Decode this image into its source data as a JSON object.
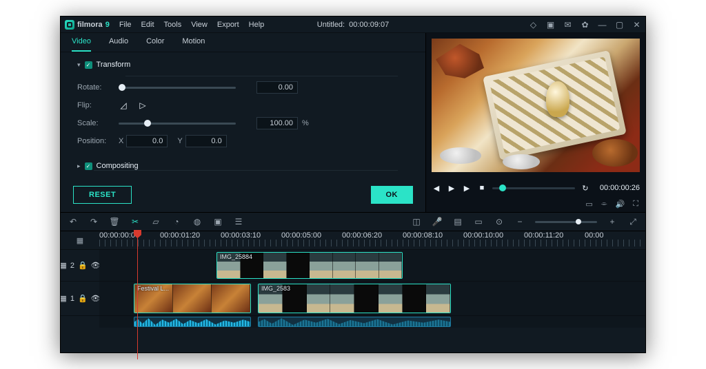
{
  "brand": {
    "name": "filmora",
    "suffix": "9"
  },
  "menus": [
    "File",
    "Edit",
    "Tools",
    "View",
    "Export",
    "Help"
  ],
  "title": {
    "name": "Untitled:",
    "time": "00:00:09:07"
  },
  "tabs": [
    "Video",
    "Audio",
    "Color",
    "Motion"
  ],
  "transform": {
    "title": "Transform",
    "rotate": {
      "label": "Rotate:",
      "value": "0.00",
      "pos": 0
    },
    "flip": {
      "label": "Flip:"
    },
    "scale": {
      "label": "Scale:",
      "value": "100.00",
      "unit": "%",
      "pos": 22
    },
    "position": {
      "label": "Position:",
      "xlabel": "X",
      "x": "0.0",
      "ylabel": "Y",
      "y": "0.0"
    }
  },
  "compositing": {
    "title": "Compositing"
  },
  "buttons": {
    "reset": "RESET",
    "ok": "OK"
  },
  "preview": {
    "time": "00:00:00:26"
  },
  "ruler": [
    "00:00:00:00",
    "00:00:01:20",
    "00:00:03:10",
    "00:00:05:00",
    "00:00:06:20",
    "00:00:08:10",
    "00:00:10:00",
    "00:00:11:20",
    "00:00"
  ],
  "clips": {
    "track2": {
      "num": "2",
      "c1": {
        "label": "IMG_25884"
      }
    },
    "track1": {
      "num": "1",
      "c1": {
        "label": "Festival L..."
      },
      "c2": {
        "label": "IMG_2583"
      }
    }
  }
}
